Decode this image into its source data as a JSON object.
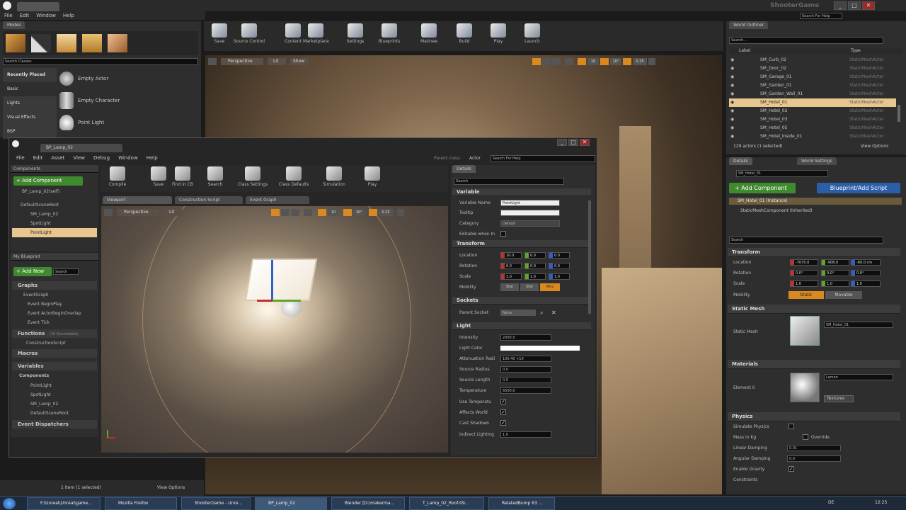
{
  "app": {
    "title_tab": "",
    "game_name": "ShooterGame",
    "search_placeholder": "Search For Help",
    "menu": [
      "File",
      "Edit",
      "Window",
      "Help"
    ]
  },
  "modes": {
    "title": "Modes",
    "search_placeholder": "Search Classes",
    "categories": [
      "Recently Placed",
      "Basic",
      "Lights",
      "Visual Effects",
      "BSP"
    ],
    "items": [
      {
        "label": "Empty Actor"
      },
      {
        "label": "Empty Character"
      },
      {
        "label": "Point Light"
      }
    ]
  },
  "main_toolbar": [
    {
      "label": "Save",
      "icon": "save-icon"
    },
    {
      "label": "Source Control",
      "icon": "source-control-icon"
    },
    {
      "label": "Content",
      "icon": "content-icon"
    },
    {
      "label": "Marketplace",
      "icon": "marketplace-icon"
    },
    {
      "label": "Settings",
      "icon": "settings-icon"
    },
    {
      "label": "Blueprints",
      "icon": "blueprints-icon"
    },
    {
      "label": "Matinee",
      "icon": "matinee-icon"
    },
    {
      "label": "Build",
      "icon": "build-icon"
    },
    {
      "label": "Play",
      "icon": "play-icon"
    },
    {
      "label": "Launch",
      "icon": "launch-icon"
    }
  ],
  "viewport": {
    "perspective": "Perspective",
    "lit": "Lit",
    "show": "Show",
    "snap_values": [
      "10",
      "10°",
      "0.25"
    ]
  },
  "world_outliner": {
    "title": "World Outliner",
    "search_placeholder": "Search...",
    "col_label": "Label",
    "col_type": "Type",
    "rows": [
      {
        "label": "SM_Curb_02",
        "type": "StaticMeshActor"
      },
      {
        "label": "SM_Door_02",
        "type": "StaticMeshActor"
      },
      {
        "label": "SM_Garage_01",
        "type": "StaticMeshActor"
      },
      {
        "label": "SM_Garden_01",
        "type": "StaticMeshActor"
      },
      {
        "label": "SM_Garden_Wall_01",
        "type": "StaticMeshActor"
      },
      {
        "label": "SM_Hotel_01",
        "type": "StaticMeshActor"
      },
      {
        "label": "SM_Hotel_02",
        "type": "StaticMeshActor"
      },
      {
        "label": "SM_Hotel_03",
        "type": "StaticMeshActor"
      },
      {
        "label": "SM_Hotel_05",
        "type": "StaticMeshActor"
      },
      {
        "label": "SM_Hotel_Inside_01",
        "type": "StaticMeshActor"
      }
    ],
    "selected_index": 5,
    "footer": "129 actors (1 selected)",
    "view_options": "View Options"
  },
  "details": {
    "tab_details": "Details",
    "tab_world": "World Settings",
    "name_value": "SM_Hotel_01",
    "add_component": "+ Add Component",
    "blueprint_button": "Blueprint/Add Script",
    "instance_row": "SM_Hotel_01 (Instance)",
    "component_row": "StaticMeshComponent (Inherited)",
    "search_placeholder": "Search",
    "transform_title": "Transform",
    "location_label": "Location",
    "rotation_label": "Rotation",
    "scale_label": "Scale",
    "mobility_label": "Mobility",
    "location": [
      "-7070.0",
      "-908.0",
      "-80.0 cm"
    ],
    "rotation": [
      "0.0°",
      "0.0°",
      "0.0°"
    ],
    "scale": [
      "1.0",
      "1.0",
      "1.0"
    ],
    "mobility_options": [
      "Static",
      "Movable"
    ],
    "static_mesh_title": "Static Mesh",
    "static_mesh_label": "Static Mesh",
    "static_mesh_value": "SM_Hotel_01",
    "materials_title": "Materials",
    "element_label": "Element 0",
    "material_value": "Lemon",
    "textures_label": "Textures",
    "physics_title": "Physics",
    "simulate_physics": "Simulate Physics",
    "mass_label": "Mass in Kg",
    "override_label": "Override",
    "linear_damping_label": "Linear Damping",
    "linear_damping": "0.01",
    "angular_damping_label": "Angular Damping",
    "angular_damping": "0.0",
    "enable_gravity": "Enable Gravity",
    "constraints": "Constraints"
  },
  "bp_window": {
    "tab": "BP_Lamp_02",
    "menu": [
      "File",
      "Edit",
      "Asset",
      "View",
      "Debug",
      "Window",
      "Help"
    ],
    "parent_class_label": "Parent class:",
    "parent_class": "Actor",
    "search_placeholder": "Search For Help",
    "components_title": "Components",
    "add_component": "+ Add Component",
    "self_item": "BP_Lamp_02(self)",
    "tree": [
      "DefaultSceneRoot",
      "SM_Lamp_02",
      "SpotLight",
      "PointLight"
    ],
    "selected_tree": "PointLight",
    "toolbar": [
      {
        "label": "Compile",
        "icon": "compile-icon"
      },
      {
        "label": "Save",
        "icon": "save-icon"
      },
      {
        "label": "Find in CB",
        "icon": "find-in-cb-icon"
      },
      {
        "label": "Search",
        "icon": "search-icon"
      },
      {
        "label": "Class Settings",
        "icon": "class-settings-icon"
      },
      {
        "label": "Class Defaults",
        "icon": "class-defaults-icon"
      },
      {
        "label": "Simulation",
        "icon": "simulation-icon"
      },
      {
        "label": "Play",
        "icon": "play-icon"
      }
    ],
    "tabs": [
      "Viewport",
      "Construction Script",
      "Event Graph"
    ],
    "viewport_perspective": "Perspective",
    "viewport_lit": "Lit",
    "snap_values": [
      "10",
      "10°",
      "0.25"
    ],
    "my_blueprint_title": "My Blueprint",
    "add_new": "+ Add New",
    "search_ph": "Search",
    "graphs_title": "Graphs",
    "event_graph": "EventGraph",
    "events": [
      "Event BeginPlay",
      "Event ActorBeginOverlap",
      "Event Tick"
    ],
    "functions_title": "Functions",
    "functions_count": "(16 Overridable)",
    "construction_script": "ConstructionScript",
    "macros_title": "Macros",
    "variables_title": "Variables",
    "components_group": "Components",
    "component_vars": [
      "PointLight",
      "SpotLight",
      "SM_Lamp_02",
      "DefaultSceneRoot"
    ],
    "dispatchers_title": "Event Dispatchers",
    "details_title": "Details",
    "details_search": "Search",
    "variable_title": "Variable",
    "variable_name_label": "Variable Name",
    "variable_name": "PointLight",
    "tooltip_label": "Tooltip",
    "category_label": "Category",
    "category_value": "Default",
    "editable_label": "Editable when In",
    "transform_title": "Transform",
    "location_label": "Location",
    "rotation_label": "Rotation",
    "scale_label": "Scale",
    "mobility_label": "Mobility",
    "location": [
      "10.0",
      "0.0",
      "0.0"
    ],
    "rotation": [
      "0.0",
      "0.0",
      "0.0"
    ],
    "scale": [
      "1.0",
      "1.0",
      "1.0"
    ],
    "mobility_options": [
      "Stat",
      "Stat",
      "Mov"
    ],
    "sockets_title": "Sockets",
    "parent_socket_label": "Parent Socket",
    "parent_socket": "None",
    "light_title": "Light",
    "intensity_label": "Intensity",
    "intensity": "2000.0",
    "light_color_label": "Light Color",
    "attenuation_label": "Attenuation Radi",
    "attenuation": "100.40 +10",
    "source_radius_label": "Source Radius",
    "source_radius": "0.0",
    "source_length_label": "Source Length",
    "source_length": "0.0",
    "temperature_label": "Temperature",
    "temperature": "6500.0",
    "use_temperature_label": "Use Temperatu",
    "affects_world_label": "Affects World",
    "cast_shadows_label": "Cast Shadows",
    "indirect_label": "Indirect Lighting",
    "indirect": "1.0"
  },
  "content_footer": {
    "items": "1 item (1 selected)",
    "view_options": "View Options"
  },
  "taskbar": {
    "items": [
      "F:\\Unreal\\Unreal\\game...",
      "Mozilla Firefox",
      "ShooterGame - Unre...",
      "BP_Lamp_02",
      "Blender [D:\\makerma...",
      "T_Lamp_02_Roof-09...",
      "RelatedBump 63 ..."
    ],
    "lang": "DE",
    "time": "12:25"
  }
}
